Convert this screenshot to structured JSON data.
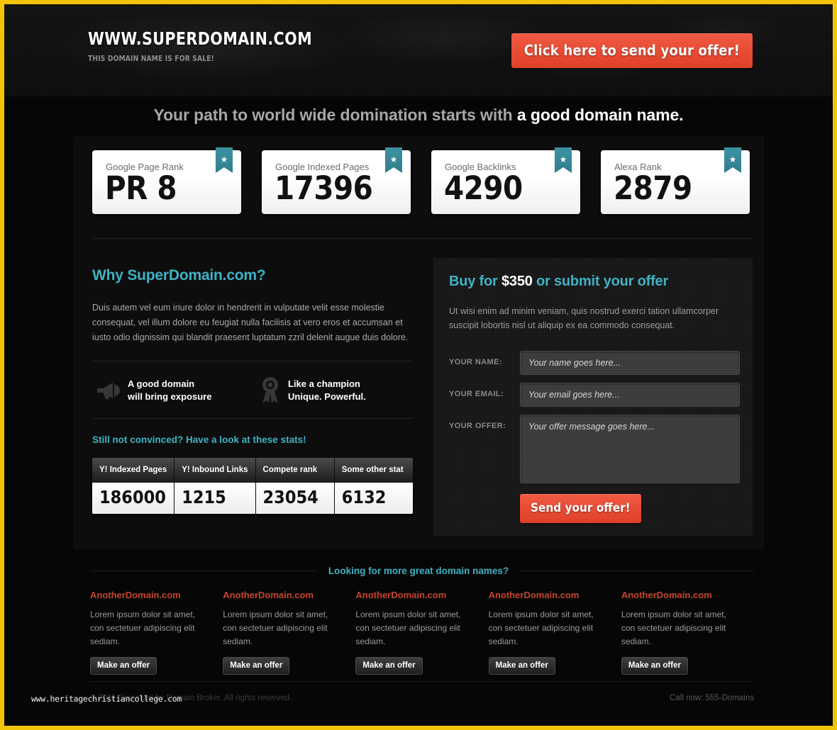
{
  "brand": {
    "title": "WWW.SUPERDOMAIN.COM",
    "subtitle": "THIS DOMAIN NAME IS FOR SALE!",
    "cta_label": "Click here to send your offer!"
  },
  "headline": {
    "lead": "Your path to world wide domination starts with ",
    "highlight": "a good domain name",
    "period": "."
  },
  "stats": [
    {
      "label": "Google Page Rank",
      "value": "PR 8",
      "badge": "star-icon"
    },
    {
      "label": "Google Indexed Pages",
      "value": "17396",
      "badge": "star-icon"
    },
    {
      "label": "Google Backlinks",
      "value": "4290",
      "badge": "star-icon"
    },
    {
      "label": "Alexa Rank",
      "value": "2879",
      "badge": "star-icon"
    }
  ],
  "why": {
    "heading": "Why SuperDomain.com?",
    "body": "Duis autem vel eum iriure dolor in hendrerit in vulputate velit esse molestie consequat, vel illum dolore eu feugiat nulla facilisis at vero eros et accumsan et iusto odio dignissim qui blandit praesent luptatum zzril delenit augue duis dolore.",
    "features": [
      {
        "icon": "megaphone-icon",
        "line1": "A good domain",
        "line2": "will bring exposure"
      },
      {
        "icon": "award-ribbon-icon",
        "line1": "Like a champion",
        "line2": "Unique. Powerful."
      }
    ],
    "stats_heading": "Still not convinced? Have a look at these stats!",
    "table": {
      "headers": [
        "Y! Indexed Pages",
        "Y! Inbound Links",
        "Compete rank",
        "Some other stat"
      ],
      "values": [
        "186000",
        "1215",
        "23054",
        "6132"
      ]
    }
  },
  "buy": {
    "title_pre": "Buy for ",
    "price": "$350",
    "title_post": " or submit your offer",
    "body": "Ut wisi enim ad minim veniam, quis nostrud exerci tation ullamcorper suscipit lobortis nisl ut aliquip ex ea commodo consequat.",
    "form": {
      "name_label": "Your name:",
      "name_placeholder": "Your name goes here...",
      "name_value": "",
      "email_label": "Your email:",
      "email_placeholder": "Your email goes here...",
      "email_value": "",
      "offer_label": "Your offer:",
      "offer_placeholder": "Your offer message goes here...",
      "offer_value": "",
      "submit_label": "Send your offer!"
    }
  },
  "more_domains": {
    "heading": "Looking for more great domain names?",
    "items": [
      {
        "name": "AnotherDomain.com",
        "desc": "Lorem ipsum dolor sit amet, con sectetuer adipiscing elit sediam.",
        "button": "Make an offer"
      },
      {
        "name": "AnotherDomain.com",
        "desc": "Lorem ipsum dolor sit amet, con sectetuer adipiscing elit sediam.",
        "button": "Make an offer"
      },
      {
        "name": "AnotherDomain.com",
        "desc": "Lorem ipsum dolor sit amet, con sectetuer adipiscing elit sediam.",
        "button": "Make an offer"
      },
      {
        "name": "AnotherDomain.com",
        "desc": "Lorem ipsum dolor sit amet, con sectetuer adipiscing elit sediam.",
        "button": "Make an offer"
      },
      {
        "name": "AnotherDomain.com",
        "desc": "Lorem ipsum dolor sit amet, con sectetuer adipiscing elit sediam.",
        "button": "Make an offer"
      }
    ]
  },
  "footer": {
    "copyright": "© 2011 Copyright by Domain Broker. All rights reserved.",
    "call": "Call now: 555-Domains"
  },
  "watermark": "www.heritagechristiancollege.com",
  "colors": {
    "frame": "#f2c307",
    "teal": "#3fb2c4",
    "red": "#e0402a",
    "domain_link": "#c6442e",
    "badge": "#3d93a3"
  }
}
